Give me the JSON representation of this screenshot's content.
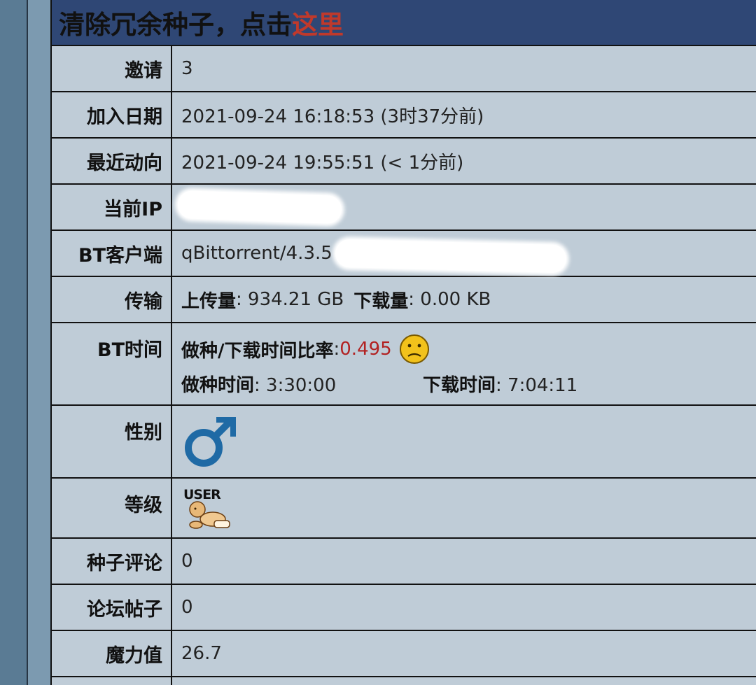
{
  "header": {
    "text": "清除冗余种子，点击",
    "link": "这里"
  },
  "rows": {
    "invite": {
      "label": "邀请",
      "value": "3"
    },
    "joined": {
      "label": "加入日期",
      "value": "2021-09-24 16:18:53 (3时37分前)"
    },
    "last_active": {
      "label": "最近动向",
      "value": "2021-09-24 19:55:51 (< 1分前)"
    },
    "current_ip": {
      "label": "当前IP"
    },
    "client": {
      "label": "BT客户端",
      "value": "qBittorrent/4.3.5 ("
    },
    "transfer": {
      "label": "传输",
      "upload_label": "上传量",
      "upload_value": ": 934.21 GB",
      "download_label": "下载量",
      "download_value": ": 0.00 KB"
    },
    "bt_time": {
      "label": "BT时间",
      "ratio_label": "做种/下载时间比率",
      "ratio_sep": ": ",
      "ratio_value": "0.495",
      "seed_label": "做种时间",
      "seed_value": ": 3:30:00",
      "dl_label": "下载时间",
      "dl_value": ": 7:04:11"
    },
    "gender": {
      "label": "性别",
      "icon": "male-symbol-icon",
      "color": "#1f6aa5"
    },
    "level": {
      "label": "等级",
      "badge_text": "USER",
      "icon": "baby-user-class-icon"
    },
    "torrent_comments": {
      "label": "种子评论",
      "value": "0"
    },
    "forum_posts": {
      "label": "论坛帖子",
      "value": "0"
    },
    "bonus": {
      "label": "魔力值",
      "value": "26.7"
    }
  },
  "colors": {
    "header_bg": "#2f4775",
    "row_bg": "#bfccd7",
    "link": "#c0392b",
    "ratio": "#b22222"
  }
}
